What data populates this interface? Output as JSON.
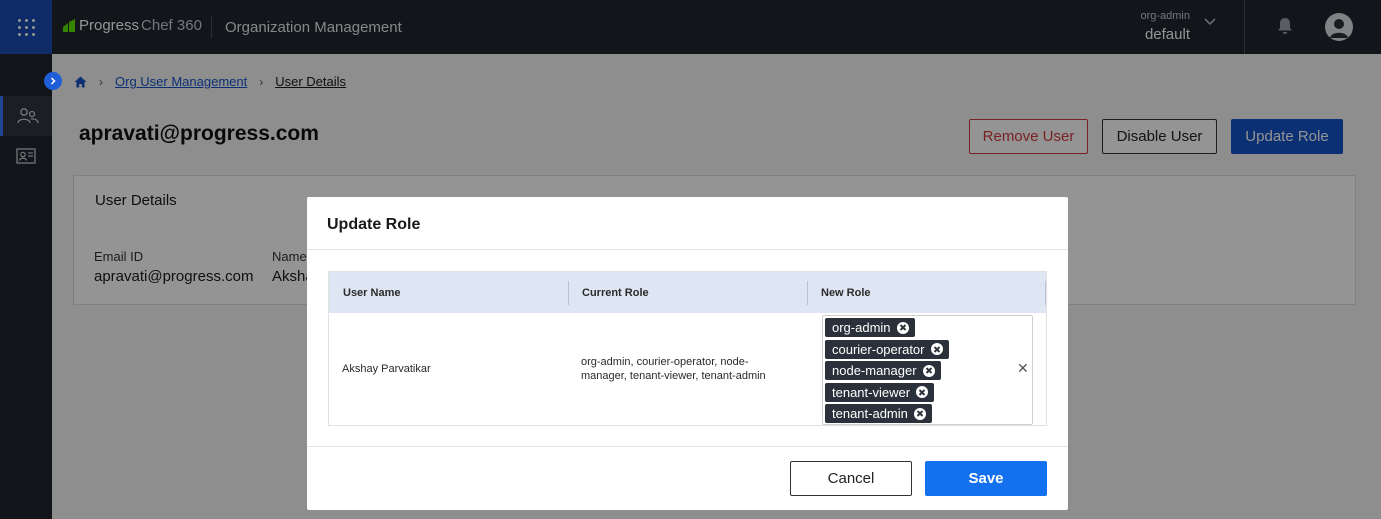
{
  "topbar": {
    "brand": "Progress",
    "product": "Chef 360",
    "app_title": "Organization Management",
    "org_label": "org-admin",
    "org_value": "default"
  },
  "breadcrumb": {
    "items": [
      "Org User Management",
      "User Details"
    ]
  },
  "page": {
    "title": "apravati@progress.com",
    "remove_user_label": "Remove User",
    "disable_user_label": "Disable User",
    "update_role_label": "Update Role"
  },
  "details": {
    "card_title": "User Details",
    "email_label": "Email ID",
    "email_value": "apravati@progress.com",
    "name_label": "Name",
    "name_value": "Aksha"
  },
  "modal": {
    "title": "Update Role",
    "columns": [
      "User Name",
      "Current Role",
      "New Role"
    ],
    "row": {
      "user_name": "Akshay Parvatikar",
      "current_role_line1": "org-admin, courier-operator, node-",
      "current_role_line2": "manager, tenant-viewer, tenant-admin",
      "new_roles": [
        "org-admin",
        "courier-operator",
        "node-manager",
        "tenant-viewer",
        "tenant-admin"
      ]
    },
    "cancel_label": "Cancel",
    "save_label": "Save"
  },
  "colors": {
    "primary": "#1454c7",
    "save": "#1371f0",
    "danger": "#d33b3b",
    "topbar": "#20252d"
  },
  "icons": [
    "apps-grid-icon",
    "chef-logo-icon",
    "chevron-down-icon",
    "bell-icon",
    "user-avatar-icon",
    "users-icon",
    "contact-card-icon",
    "chevron-right-icon",
    "home-icon",
    "close-icon"
  ]
}
